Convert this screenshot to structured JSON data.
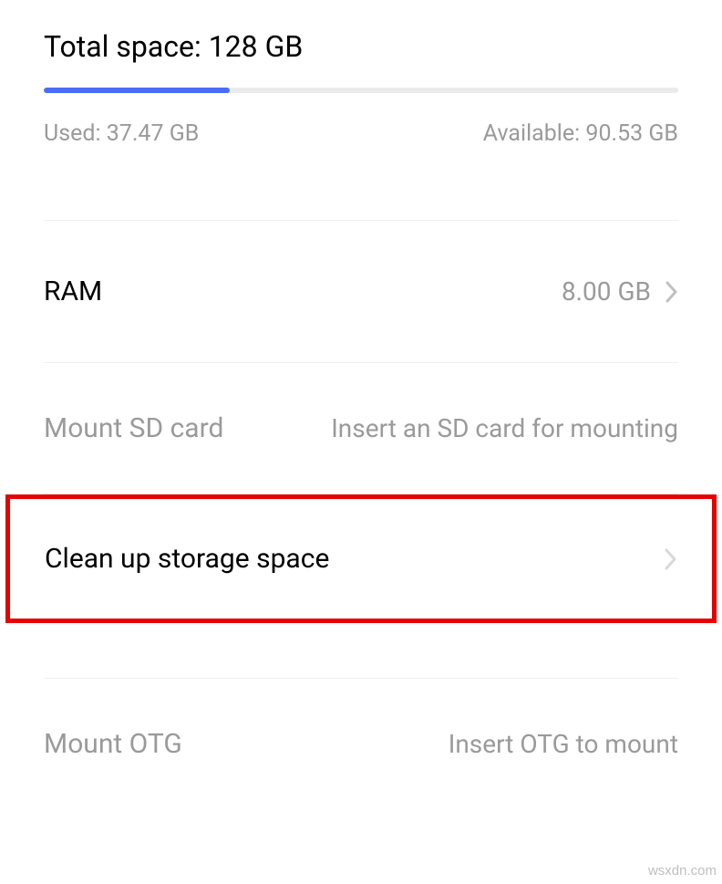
{
  "storage": {
    "total_label": "Total space: 128 GB",
    "used_label": "Used: 37.47 GB",
    "available_label": "Available: 90.53 GB",
    "used_percent": 29.3
  },
  "ram": {
    "label": "RAM",
    "value": "8.00 GB"
  },
  "sd_card": {
    "label": "Mount SD card",
    "hint": "Insert an SD card for mounting"
  },
  "cleanup": {
    "label": "Clean up storage space"
  },
  "otg": {
    "label": "Mount OTG",
    "hint": "Insert OTG to mount"
  },
  "watermark": "wsxdn.com"
}
